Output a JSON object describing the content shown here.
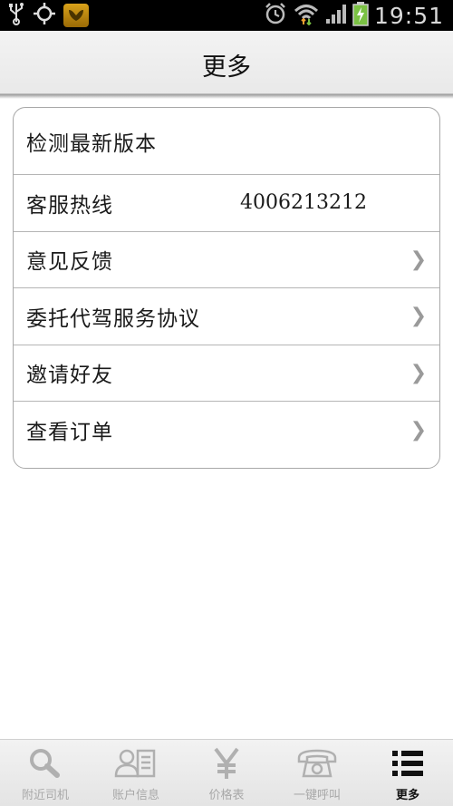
{
  "status_bar": {
    "time": "19:51",
    "icons": [
      "usb-icon",
      "gps-icon",
      "app-notification-icon",
      "alarm-icon",
      "wifi-icon",
      "signal-icon",
      "battery-charging-icon"
    ]
  },
  "header": {
    "title": "更多"
  },
  "menu": {
    "items": [
      {
        "label": "检测最新版本"
      },
      {
        "label": "客服热线",
        "value": "4006213212"
      },
      {
        "label": "意见反馈",
        "chevron": "❯"
      },
      {
        "label": "委托代驾服务协议",
        "chevron": "❯"
      },
      {
        "label": "邀请好友",
        "chevron": "❯"
      },
      {
        "label": "查看订单",
        "chevron": "❯"
      }
    ]
  },
  "tab_bar": {
    "tabs": [
      {
        "label": "附近司机",
        "icon": "search-icon",
        "active": false
      },
      {
        "label": "账户信息",
        "icon": "account-icon",
        "active": false
      },
      {
        "label": "价格表",
        "icon": "yen-icon",
        "active": false
      },
      {
        "label": "一键呼叫",
        "icon": "phone-icon",
        "active": false
      },
      {
        "label": "更多",
        "icon": "list-icon",
        "active": true
      }
    ]
  },
  "colors": {
    "tab_inactive": "#a8a8a8",
    "tab_active": "#111111",
    "chevron": "#9a9a9a"
  }
}
